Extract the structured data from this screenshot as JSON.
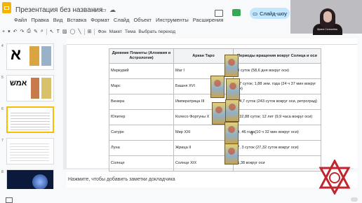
{
  "app": {
    "doc_title": "Презентация без названия",
    "slideshow_label": "Слайд-шоу"
  },
  "menu": [
    "Файл",
    "Правка",
    "Вид",
    "Вставка",
    "Формат",
    "Слайд",
    "Объект",
    "Инструменты",
    "Расширения"
  ],
  "toolbar": {
    "background_label": "Фон",
    "layout_label": "Макет",
    "theme_label": "Тема",
    "transition_label": "Выбрать переход"
  },
  "thumbnails": [
    {
      "number": "4"
    },
    {
      "number": "5"
    },
    {
      "number": "6"
    },
    {
      "number": "7"
    },
    {
      "number": "8"
    }
  ],
  "webcam_label": "Ирина Селезнёва",
  "table": {
    "headers": [
      "Древние Планеты (Алхимия и Астрология)",
      "Аркан Таро",
      "Периоды вращения вокруг Солнца и оси"
    ],
    "rows": [
      [
        "Меркурий",
        "Маг I",
        "88 суток (58,6 дня вокруг оси)"
      ],
      [
        "Марс",
        "Башня XVI",
        "687 суток; 1,88 зем. года (24 ч 37 мин вокруг оси)"
      ],
      [
        "Венера",
        "Императрица III",
        "224,7 суток (243 суток вокруг оси, ретроград)"
      ],
      [
        "Юпитер",
        "Колесо Фортуны X",
        "4332,88 суток; 12 лет (9,9 часа вокруг оси)"
      ],
      [
        "Сатурн",
        "Мир XXI",
        "29, 46 года(10 ч 32 мин вокруг оси)"
      ],
      [
        "Луна",
        "Жрица II",
        "27, 3 суток (27,32 суток вокруг оси)"
      ],
      [
        "Солнце",
        "Солнце XIX",
        "25,38 вокруг оси"
      ]
    ]
  },
  "notes_placeholder": "Нажмите, чтобы добавить заметки докладчика",
  "colors": {
    "accent": "#c2e7ff",
    "selected_thumb": "#fbbc04",
    "logo": "#f4b400"
  }
}
